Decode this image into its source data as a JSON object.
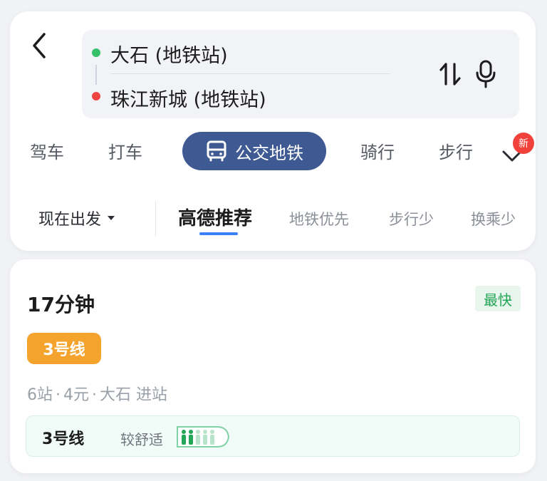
{
  "route": {
    "origin": "大石 (地铁站)",
    "destination": "珠江新城 (地铁站)"
  },
  "modes": [
    {
      "label": "驾车"
    },
    {
      "label": "打车"
    },
    {
      "label": "公交地铁",
      "active": true
    },
    {
      "label": "骑行"
    },
    {
      "label": "步行"
    }
  ],
  "new_badge": "新",
  "preferences": {
    "depart": "现在出发",
    "options": [
      "高德推荐",
      "地铁优先",
      "步行少",
      "换乘少"
    ],
    "active_index": 0
  },
  "result": {
    "duration": "17分钟",
    "tag": "最快",
    "line": "3号线",
    "stations": "6站",
    "fare": "4元",
    "entry": "大石 进站",
    "comfort_line": "3号线",
    "comfort_text": "较舒适",
    "crowd_level_filled": 2,
    "crowd_level_total": 5
  },
  "colors": {
    "mode_active_bg": "#3f5a92",
    "line_badge": "#f4a42c",
    "fast_tag_text": "#22a657",
    "origin_dot": "#34c16a",
    "destination_dot": "#ef4444",
    "tab_underline": "#3b82f6"
  },
  "icons": [
    "back-arrow-icon",
    "swap-icon",
    "microphone-icon",
    "bus-icon",
    "chevron-down-icon",
    "caret-down-icon",
    "crowd-icon"
  ]
}
